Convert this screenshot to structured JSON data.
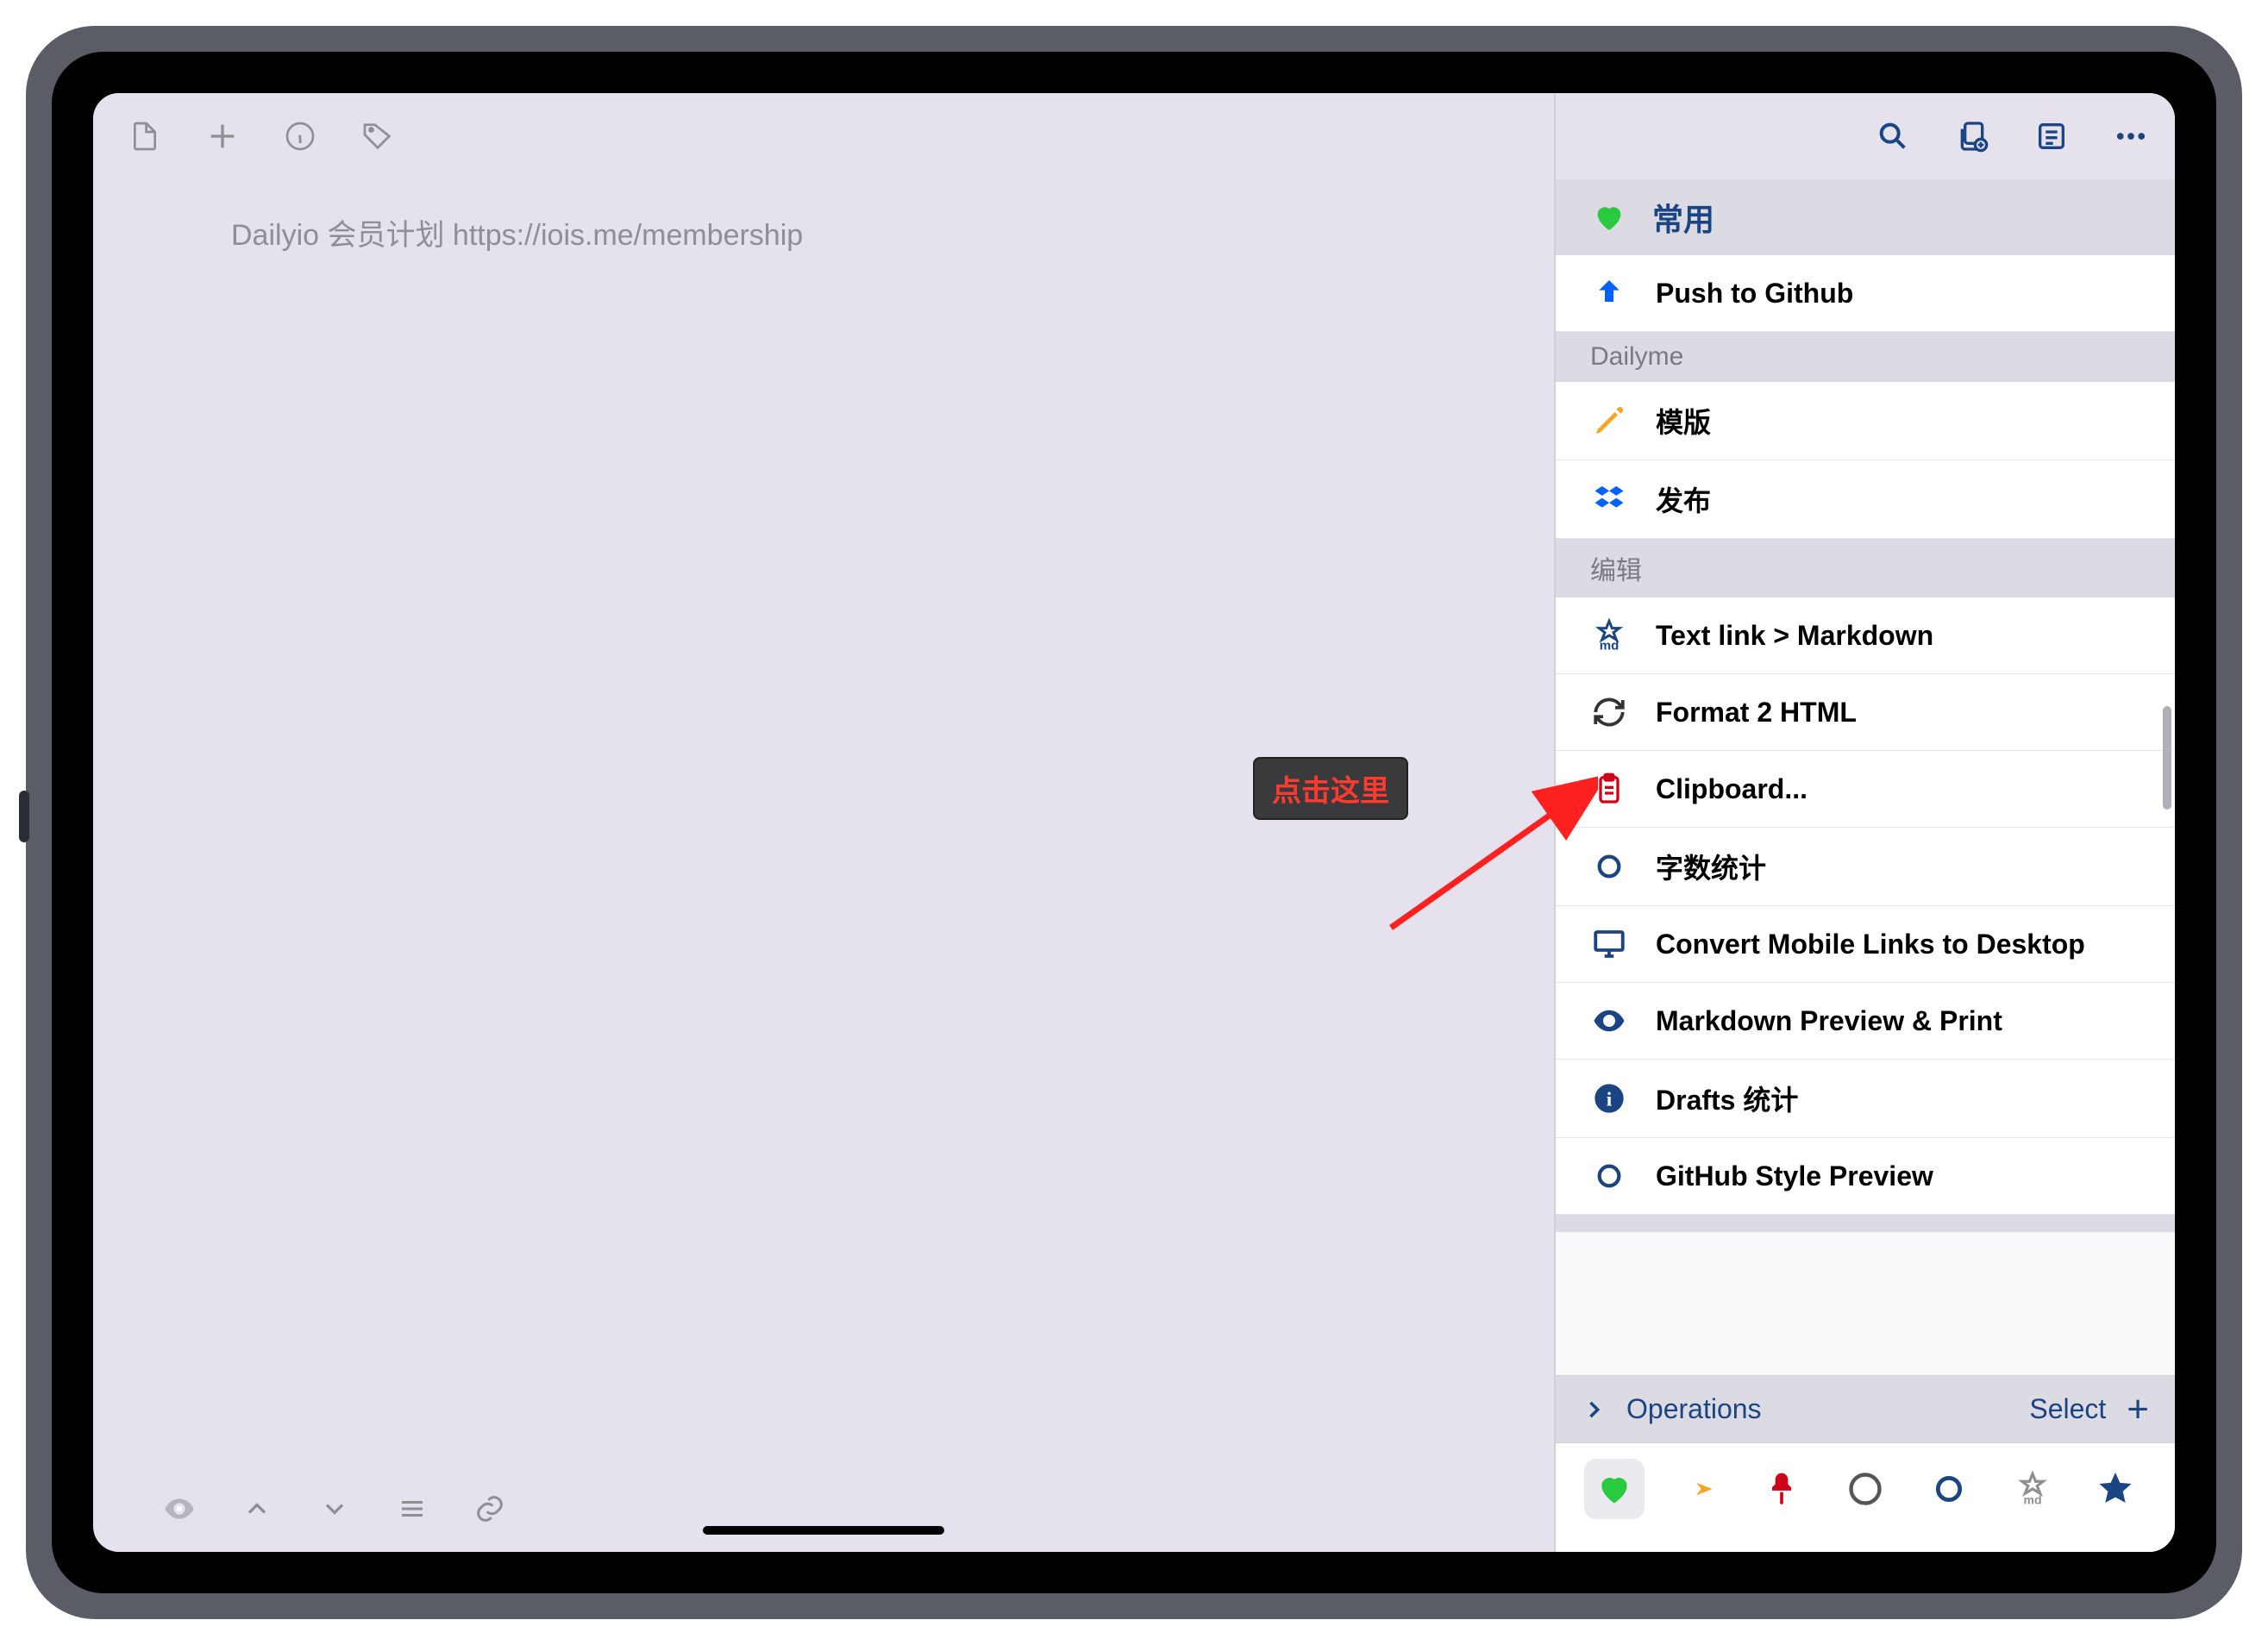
{
  "editor": {
    "content": "Dailyio 会员计划 https://iois.me/membership"
  },
  "sidebar": {
    "toolbar": {
      "search_icon": "search-icon",
      "copy_icon": "copy-icon",
      "list_icon": "list-icon",
      "more_icon": "more-icon"
    },
    "groups": [
      {
        "type": "header",
        "icon": "heart-green",
        "label": "常用"
      },
      {
        "type": "item",
        "icon": "arrow-up-blue",
        "label": "Push to Github"
      },
      {
        "type": "subheader",
        "label": "Dailyme"
      },
      {
        "type": "item",
        "icon": "pencil-orange",
        "label": "模版"
      },
      {
        "type": "item",
        "icon": "dropbox",
        "label": "发布"
      },
      {
        "type": "subheader",
        "label": "编辑"
      },
      {
        "type": "item",
        "icon": "star-md",
        "label": "Text link > Markdown"
      },
      {
        "type": "item",
        "icon": "sync",
        "label": "Format 2 HTML"
      },
      {
        "type": "item",
        "icon": "clipboard-red",
        "label": "Clipboard..."
      },
      {
        "type": "item",
        "icon": "circle-outline",
        "label": "字数统计"
      },
      {
        "type": "item",
        "icon": "desktop",
        "label": "Convert Mobile Links to Desktop"
      },
      {
        "type": "item",
        "icon": "eye-solid",
        "label": "Markdown Preview & Print"
      },
      {
        "type": "item",
        "icon": "info-circle",
        "label": "Drafts 统计"
      },
      {
        "type": "item",
        "icon": "circle-outline",
        "label": "GitHub Style Preview"
      }
    ],
    "operations": {
      "label": "Operations",
      "select": "Select",
      "add": "+"
    },
    "tabs": [
      {
        "icon": "heart-green",
        "active": true
      },
      {
        "icon": "arrow-right-orange",
        "active": false
      },
      {
        "icon": "pushpin-red",
        "active": false
      },
      {
        "icon": "moon-outline",
        "active": false
      },
      {
        "icon": "circle-outline-blue",
        "active": false
      },
      {
        "icon": "star-md-gray",
        "active": false
      },
      {
        "icon": "star-solid-blue",
        "active": false
      }
    ]
  },
  "callout": {
    "text": "点击这里"
  },
  "colors": {
    "accent_blue": "#1b4483",
    "green": "#29c940",
    "orange": "#f5a623",
    "red": "#d0021b",
    "dropbox_blue": "#0061ff"
  }
}
